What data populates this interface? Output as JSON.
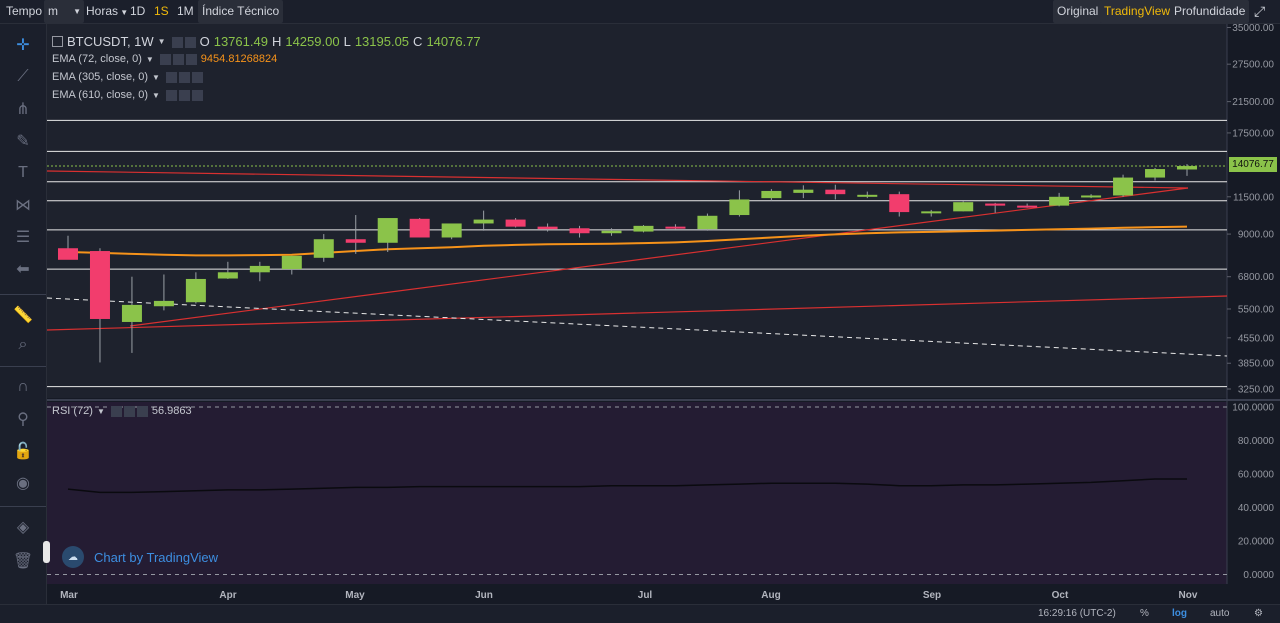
{
  "topbar": {
    "tempo_label": "Tempo",
    "unit_select": "m",
    "interval_select": "Horas",
    "intervals": [
      "1D",
      "1S",
      "1M"
    ],
    "active_interval": "1S",
    "indicators_label": "Índice Técnico",
    "views": [
      "Original",
      "TradingView",
      "Profundidade"
    ],
    "active_view": "TradingView"
  },
  "legend": {
    "symbol": "BTCUSDT, 1W",
    "open_label": "O",
    "open": "13761.49",
    "high_label": "H",
    "high": "14259.00",
    "low_label": "L",
    "low": "13195.05",
    "close_label": "C",
    "close": "14076.77",
    "ema1": "EMA (72, close, 0)",
    "ema1_value": "9454.81268824",
    "ema2": "EMA (305, close, 0)",
    "ema3": "EMA (610, close, 0)",
    "rsi": "RSI (72)",
    "rsi_value": "56.9863"
  },
  "watermark": "Chart by TradingView",
  "last_price": "14076.77",
  "bottom": {
    "time": "16:29:16 (UTC-2)",
    "pct": "%",
    "log": "log",
    "auto": "auto"
  },
  "colors": {
    "up": "#8bc34a",
    "down": "#f23d6d",
    "ema": "#f7931a",
    "trend": "#d93030",
    "rsi_bg": "#241c33"
  },
  "chart_data": {
    "type": "candlestick",
    "timeframe": "1W",
    "scale": "log",
    "y_ticks": [
      "35000.00",
      "27500.00",
      "21500.00",
      "17500.00",
      "11500.00",
      "9000.00",
      "6800.00",
      "5500.00",
      "4550.00",
      "3850.00",
      "3250.00"
    ],
    "x_ticks": [
      "Mar",
      "Apr",
      "May",
      "Jun",
      "Jul",
      "Aug",
      "Sep",
      "Oct",
      "Nov"
    ],
    "candles": [
      {
        "o": 8200,
        "h": 8900,
        "l": 7700,
        "c": 7600
      },
      {
        "o": 8050,
        "h": 8200,
        "l": 3870,
        "c": 5150
      },
      {
        "o": 5050,
        "h": 6800,
        "l": 4120,
        "c": 5650
      },
      {
        "o": 5600,
        "h": 6900,
        "l": 5450,
        "c": 5800
      },
      {
        "o": 5750,
        "h": 7000,
        "l": 5700,
        "c": 6700
      },
      {
        "o": 6720,
        "h": 7500,
        "l": 6700,
        "c": 7000
      },
      {
        "o": 7000,
        "h": 7500,
        "l": 6600,
        "c": 7300
      },
      {
        "o": 7150,
        "h": 7800,
        "l": 6900,
        "c": 7800
      },
      {
        "o": 7700,
        "h": 9000,
        "l": 7500,
        "c": 8700
      },
      {
        "o": 8700,
        "h": 10200,
        "l": 7900,
        "c": 8500
      },
      {
        "o": 8500,
        "h": 9900,
        "l": 8000,
        "c": 10000
      },
      {
        "o": 9950,
        "h": 10000,
        "l": 8800,
        "c": 8800
      },
      {
        "o": 8800,
        "h": 9600,
        "l": 8700,
        "c": 9650
      },
      {
        "o": 9650,
        "h": 10500,
        "l": 9200,
        "c": 9900
      },
      {
        "o": 9900,
        "h": 10000,
        "l": 9400,
        "c": 9450
      },
      {
        "o": 9450,
        "h": 9650,
        "l": 9150,
        "c": 9300
      },
      {
        "o": 9350,
        "h": 9500,
        "l": 8800,
        "c": 9050
      },
      {
        "o": 9050,
        "h": 9350,
        "l": 8900,
        "c": 9200
      },
      {
        "o": 9150,
        "h": 9550,
        "l": 9100,
        "c": 9500
      },
      {
        "o": 9450,
        "h": 9600,
        "l": 9300,
        "c": 9400
      },
      {
        "o": 9300,
        "h": 10300,
        "l": 9200,
        "c": 10150
      },
      {
        "o": 10200,
        "h": 12000,
        "l": 10100,
        "c": 11300
      },
      {
        "o": 11400,
        "h": 12100,
        "l": 11200,
        "c": 11950
      },
      {
        "o": 11800,
        "h": 12400,
        "l": 11400,
        "c": 12050
      },
      {
        "o": 12050,
        "h": 12450,
        "l": 11300,
        "c": 11700
      },
      {
        "o": 11650,
        "h": 11900,
        "l": 11400,
        "c": 11650
      },
      {
        "o": 11700,
        "h": 11900,
        "l": 10100,
        "c": 10400
      },
      {
        "o": 10350,
        "h": 10550,
        "l": 10100,
        "c": 10450
      },
      {
        "o": 10450,
        "h": 11150,
        "l": 10450,
        "c": 11100
      },
      {
        "o": 11000,
        "h": 11050,
        "l": 10350,
        "c": 10850
      },
      {
        "o": 10850,
        "h": 11000,
        "l": 10700,
        "c": 10800
      },
      {
        "o": 10850,
        "h": 11800,
        "l": 10800,
        "c": 11500
      },
      {
        "o": 11450,
        "h": 11700,
        "l": 11400,
        "c": 11600
      },
      {
        "o": 11600,
        "h": 13300,
        "l": 11500,
        "c": 13050
      },
      {
        "o": 13050,
        "h": 13900,
        "l": 12800,
        "c": 13800
      },
      {
        "o": 13761.49,
        "h": 14259,
        "l": 13195.05,
        "c": 14076.77
      }
    ],
    "ema72": [
      8000,
      7950,
      7900,
      7860,
      7820,
      7820,
      7840,
      7860,
      7950,
      8050,
      8150,
      8200,
      8250,
      8330,
      8380,
      8420,
      8430,
      8450,
      8480,
      8520,
      8600,
      8700,
      8800,
      8900,
      8980,
      9050,
      9100,
      9130,
      9170,
      9210,
      9250,
      9290,
      9330,
      9380,
      9420,
      9454.81
    ],
    "rsi": [
      51,
      49,
      49,
      49.5,
      50,
      50.5,
      50.5,
      51,
      51.5,
      52,
      52,
      52.5,
      52.5,
      52.5,
      52.5,
      52.5,
      52.5,
      53,
      53,
      53,
      53.5,
      54,
      54.5,
      54.5,
      54.5,
      54,
      53,
      53,
      53.5,
      53.5,
      54,
      54.5,
      55,
      56,
      57,
      56.9863
    ],
    "rsi_ylim": [
      0,
      100
    ],
    "rsi_ticks": [
      "100.0000",
      "80.0000",
      "60.0000",
      "40.0000",
      "20.0000",
      "0.0000"
    ]
  }
}
